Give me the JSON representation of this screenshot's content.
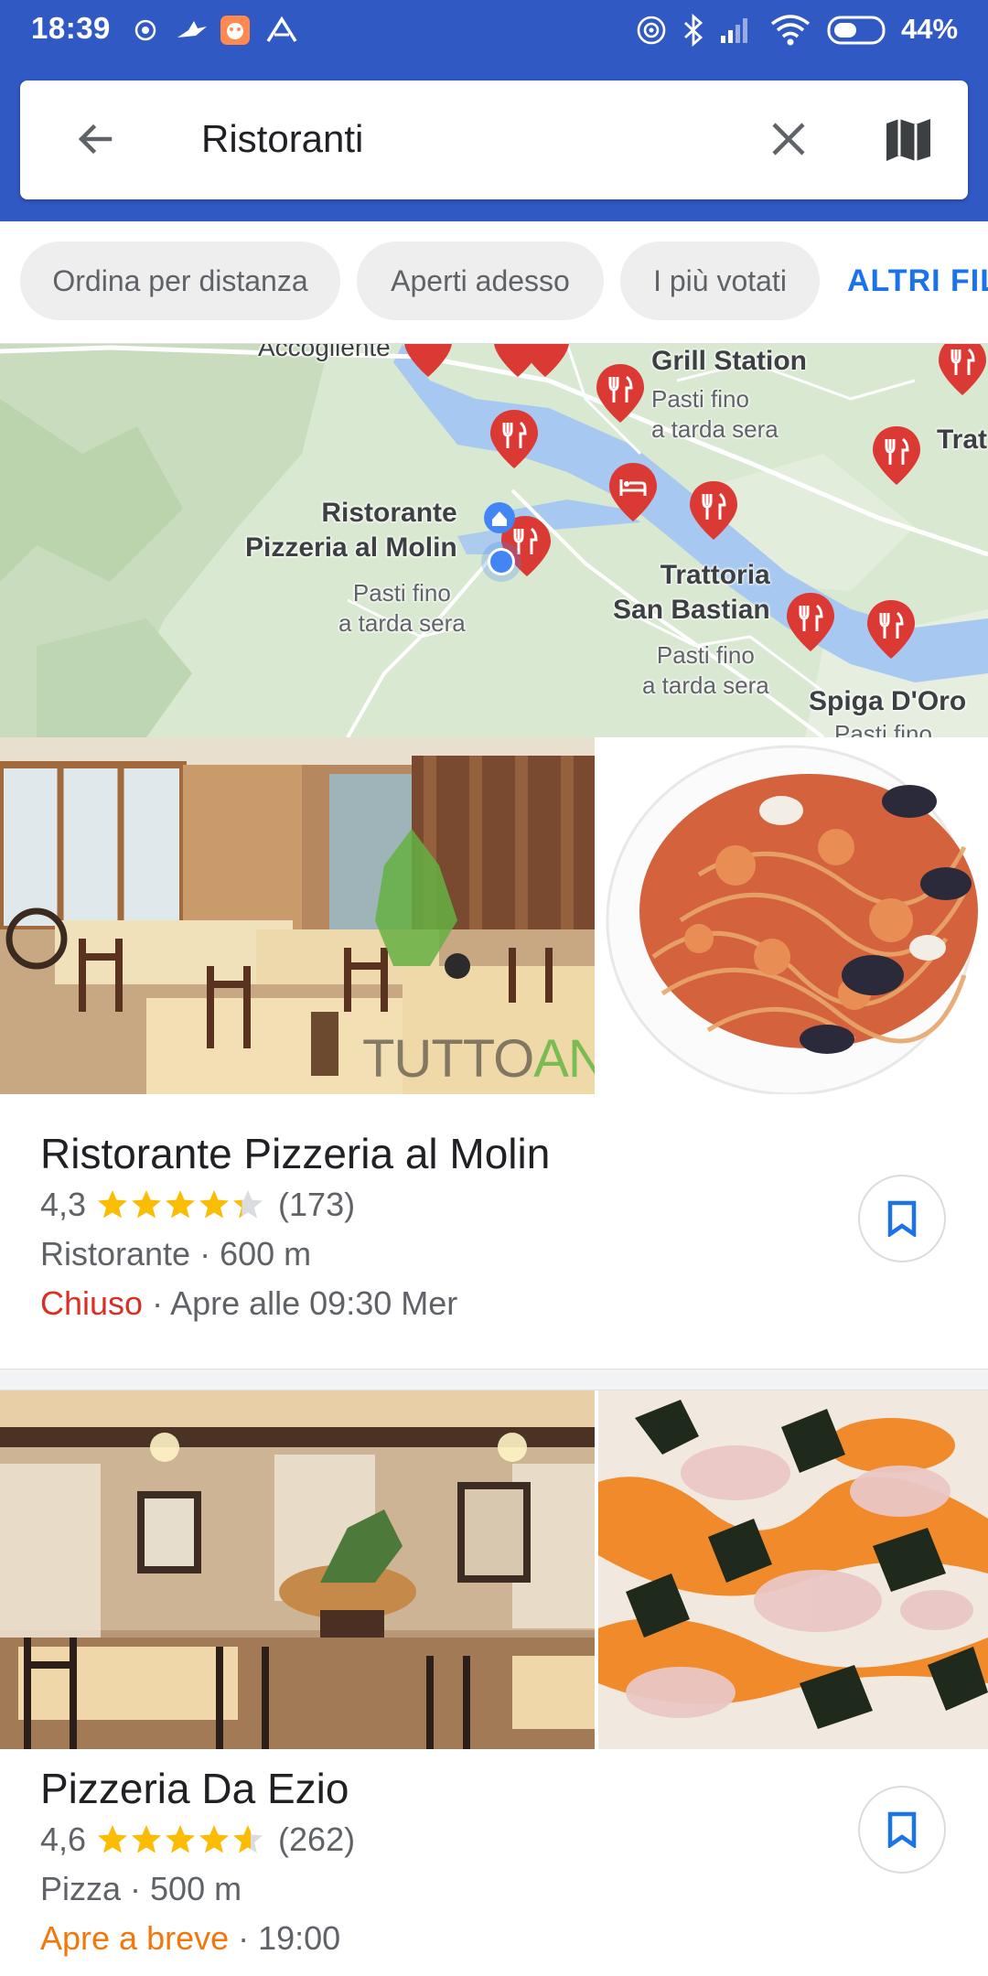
{
  "status_bar": {
    "time": "18:39",
    "battery": "44%",
    "icons": [
      "whatsapp-icon",
      "bird-app-icon",
      "alarm-app-icon",
      "navigation-app-icon",
      "hotspot-icon",
      "bluetooth-icon",
      "signal-icon",
      "wifi-icon",
      "battery-icon"
    ]
  },
  "search": {
    "query": "Ristoranti",
    "back_icon": "arrow-left-icon",
    "clear_icon": "close-icon",
    "map_icon": "map-icon"
  },
  "filters": {
    "chips": [
      "Ordina per distanza",
      "Aperti adesso",
      "I più votati"
    ],
    "more": "ALTRI FILTRI"
  },
  "map": {
    "labels": {
      "top_left": "Accogliente",
      "grill_name": "Grill Station",
      "grill_sub": "Pasti fino\na tarda sera",
      "trat_right": "Trat",
      "molin_name": "Ristorante\nPizzeria al Molin",
      "molin_sub": "Pasti fino\na tarda sera",
      "bastian_name": "Trattoria\nSan Bastian",
      "bastian_sub": "Pasti fino\na tarda sera",
      "spiga_name": "Spiga D'Oro",
      "spiga_sub": "Pasti fino"
    },
    "colors": {
      "land": "#d9e8d0",
      "water": "#a7c8f0",
      "pin": "#db3a34",
      "road": "#ffffff"
    }
  },
  "results": [
    {
      "name": "Ristorante Pizzeria al Molin",
      "rating": "4,3",
      "rating_value": 4.3,
      "reviews": "(173)",
      "category_distance": "Ristorante · 600 m",
      "status": "Chiuso",
      "hours": " · Apre alle 09:30 Mer",
      "watermark": [
        "TUTTO",
        "ANDROID"
      ]
    },
    {
      "name": "Pizzeria Da Ezio",
      "rating": "4,6",
      "rating_value": 4.6,
      "reviews": "(262)",
      "category_distance": "Pizza · 500 m",
      "status": "Apre a breve",
      "hours": " · 19:00"
    }
  ],
  "colors": {
    "header": "#3159c4",
    "accent": "#1a73e8",
    "closed": "#d93025",
    "opening_soon": "#f2780c",
    "star": "#fbbc04"
  }
}
